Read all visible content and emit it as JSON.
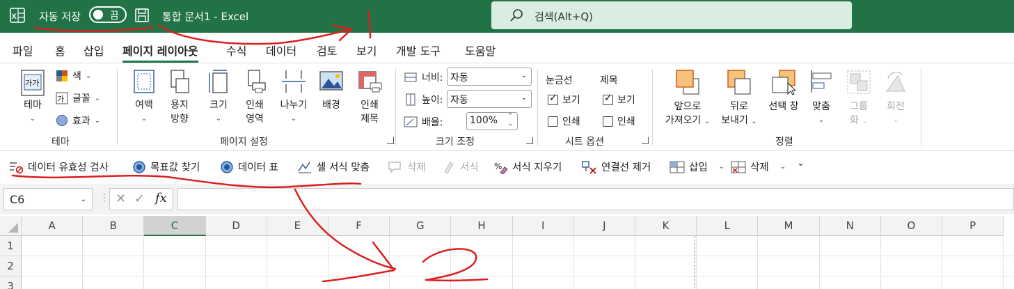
{
  "title_bar": {
    "autosave_label": "자동 저장",
    "autosave_state": "끔",
    "document_title": "통합 문서1  -  Excel",
    "search_placeholder": "검색(Alt+Q)",
    "colors": {
      "background": "#217346",
      "search_bg": "#d9ede1"
    }
  },
  "tabs": [
    {
      "label": "파일",
      "active": false
    },
    {
      "label": "홈",
      "active": false
    },
    {
      "label": "삽입",
      "active": false
    },
    {
      "label": "페이지 레이아웃",
      "active": true
    },
    {
      "label": "수식",
      "active": false
    },
    {
      "label": "데이터",
      "active": false
    },
    {
      "label": "검토",
      "active": false
    },
    {
      "label": "보기",
      "active": false
    },
    {
      "label": "개발 도구",
      "active": false
    },
    {
      "label": "도움말",
      "active": false
    }
  ],
  "ribbon": {
    "theme_group": {
      "label": "테마",
      "theme_button": "테마",
      "colors": "색",
      "fonts": "글꼴",
      "effects": "효과"
    },
    "page_setup_group": {
      "label": "페이지 설정",
      "margins": "여백",
      "orientation_line1": "용지",
      "orientation_line2": "방향",
      "size": "크기",
      "print_area_line1": "인쇄",
      "print_area_line2": "영역",
      "breaks": "나누기",
      "background": "배경",
      "print_titles_line1": "인쇄",
      "print_titles_line2": "제목"
    },
    "scale_group": {
      "label": "크기 조정",
      "width_label": "너비:",
      "width_value": "자동",
      "height_label": "높이:",
      "height_value": "자동",
      "scale_label": "배율:",
      "scale_value": "100%"
    },
    "sheet_options_group": {
      "label": "시트 옵션",
      "gridlines_header": "눈금선",
      "headings_header": "제목",
      "gridlines_view": "보기",
      "gridlines_view_checked": true,
      "gridlines_print": "인쇄",
      "gridlines_print_checked": false,
      "headings_view": "보기",
      "headings_view_checked": true,
      "headings_print": "인쇄",
      "headings_print_checked": false
    },
    "arrange_group": {
      "label": "정렬",
      "bring_forward_line1": "앞으로",
      "bring_forward_line2": "가져오기",
      "send_backward_line1": "뒤로",
      "send_backward_line2": "보내기",
      "selection_pane": "선택 창",
      "align": "맞춤",
      "group_line1": "그룹",
      "group_line2": "화",
      "rotate": "회전"
    }
  },
  "quick_access": [
    {
      "label": "데이터 유효성 검사",
      "icon": "data-validation-icon",
      "disabled": false
    },
    {
      "label": "목표값 찾기",
      "icon": "goal-seek-icon",
      "disabled": false
    },
    {
      "label": "데이터 표",
      "icon": "data-table-icon",
      "disabled": false
    },
    {
      "label": "셀 서식 맞춤",
      "icon": "format-match-icon",
      "disabled": false
    },
    {
      "label": "삭제",
      "icon": "delete-comment-icon",
      "disabled": true
    },
    {
      "label": "서식",
      "icon": "format-icon",
      "disabled": true
    },
    {
      "label": "서식 지우기",
      "icon": "clear-format-icon",
      "disabled": false
    },
    {
      "label": "연결선 제거",
      "icon": "remove-links-icon",
      "disabled": false
    },
    {
      "label": "삽입",
      "icon": "insert-cells-icon",
      "disabled": false
    },
    {
      "label": "삭제",
      "icon": "delete-cells-icon",
      "disabled": false
    }
  ],
  "formula_bar": {
    "name_box": "C6",
    "fx_label": "fx",
    "formula": ""
  },
  "grid": {
    "columns": [
      "A",
      "B",
      "C",
      "D",
      "E",
      "F",
      "G",
      "H",
      "I",
      "J",
      "K",
      "L",
      "M",
      "N",
      "O",
      "P"
    ],
    "selected_column": "C",
    "rows": [
      "1",
      "2",
      "3"
    ]
  },
  "annotations": {
    "marker_1": "1",
    "marker_2": "2",
    "stroke_color": "#d9201e"
  }
}
